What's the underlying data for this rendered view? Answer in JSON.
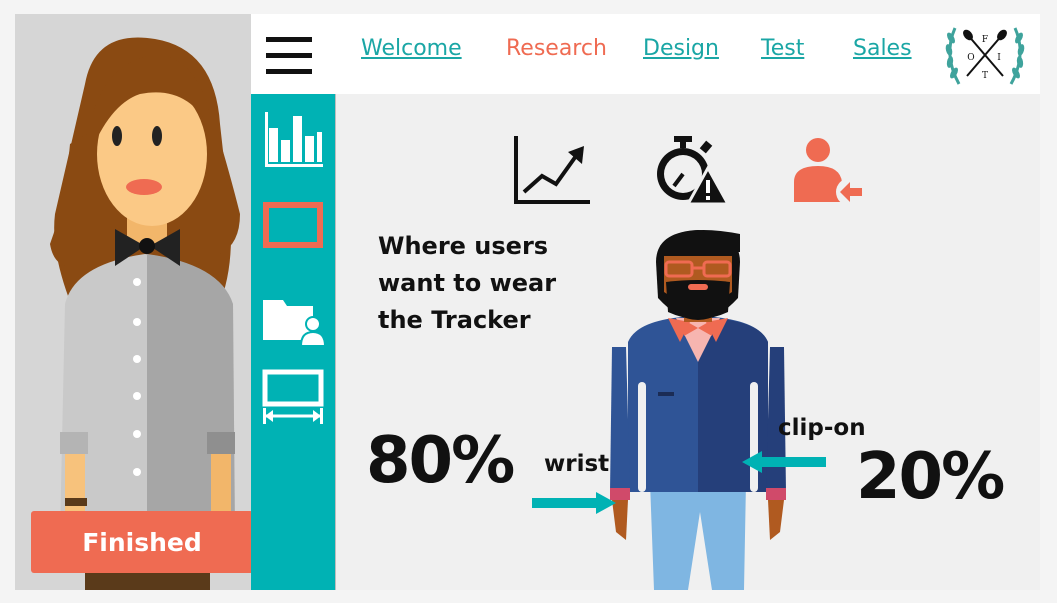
{
  "navigation": {
    "links": [
      {
        "label": "Welcome",
        "active": false
      },
      {
        "label": "Research",
        "active": true
      },
      {
        "label": "Design",
        "active": false
      },
      {
        "label": "Test",
        "active": false
      },
      {
        "label": "Sales",
        "active": false
      }
    ],
    "menu_icon": "hamburger-icon",
    "logo_letters": [
      "F",
      "O",
      "I",
      "T"
    ]
  },
  "toolbar": {
    "tools": [
      {
        "icon": "bar-chart-icon",
        "selected": false
      },
      {
        "icon": "screen-rectangle-icon",
        "selected": true
      },
      {
        "icon": "user-folder-icon",
        "selected": false
      },
      {
        "icon": "width-measure-icon",
        "selected": false
      }
    ]
  },
  "persona": {
    "finished_label": "Finished"
  },
  "main": {
    "top_icons": [
      "line-chart-icon",
      "stopwatch-warning-icon",
      "user-arrow-icon"
    ],
    "question": "Where users want to wear the Tracker",
    "wrist": {
      "percent": "80%",
      "label": "wrist"
    },
    "clip_on": {
      "percent": "20%",
      "label": "clip-on"
    }
  },
  "colors": {
    "accent_teal": "#00b2b4",
    "accent_coral": "#ef6b52",
    "link_teal": "#1aa6a5"
  }
}
